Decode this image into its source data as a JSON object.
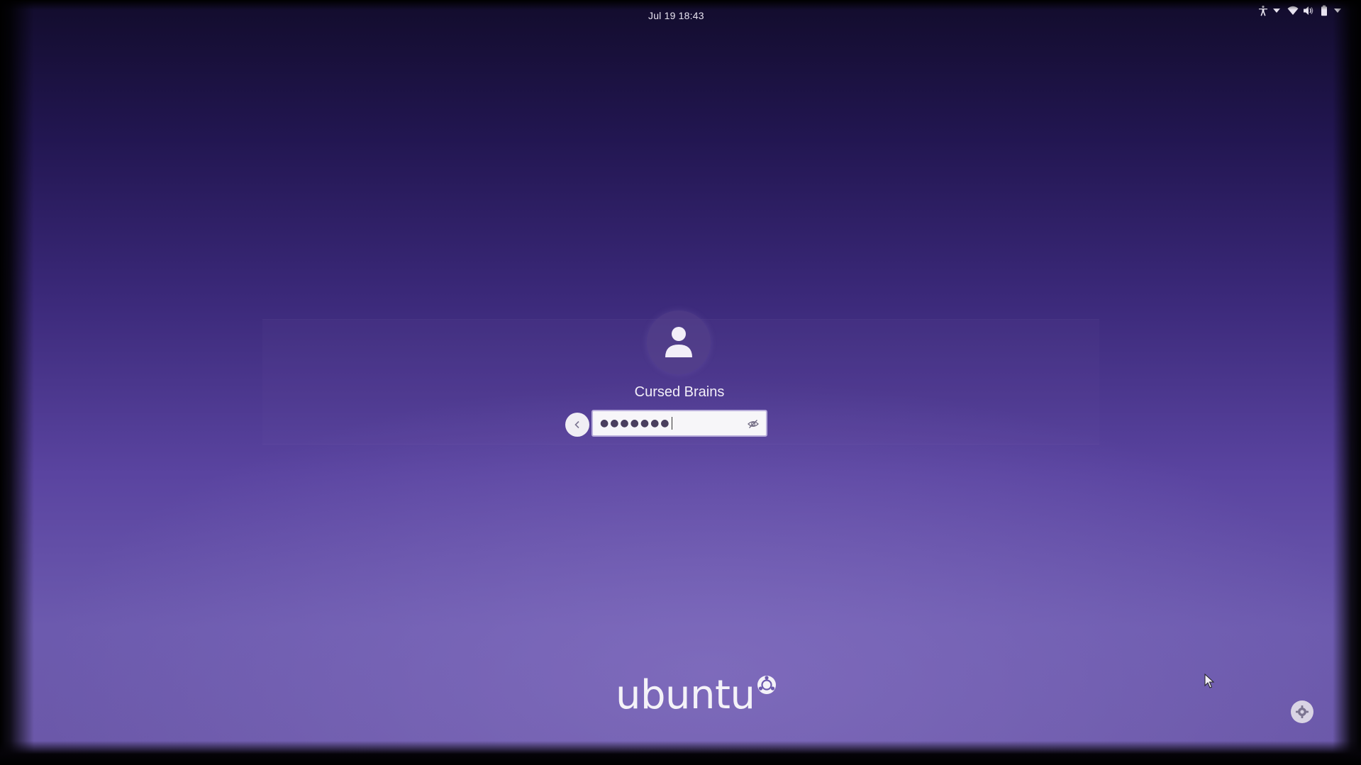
{
  "top_bar": {
    "datetime": "Jul 19  18:43",
    "tray_icons": [
      "accessibility-icon",
      "wifi-icon",
      "volume-icon",
      "battery-icon"
    ]
  },
  "login": {
    "avatar_icon": "user-icon",
    "username": "Cursed Brains",
    "password_mask": "●●●●●●●",
    "password_placeholder": "",
    "back_icon": "chevron-left-icon",
    "reveal_icon": "eye-slash-icon"
  },
  "branding": {
    "logo_text": "ubuntu"
  },
  "bottom_right": {
    "settings_icon": "gear-icon"
  },
  "colors": {
    "background_top": "#120c2c",
    "background_bottom": "#6c5aae",
    "text": "#f2eef8",
    "field_bg": "#f7f6f9",
    "field_border": "#b9aedb"
  }
}
